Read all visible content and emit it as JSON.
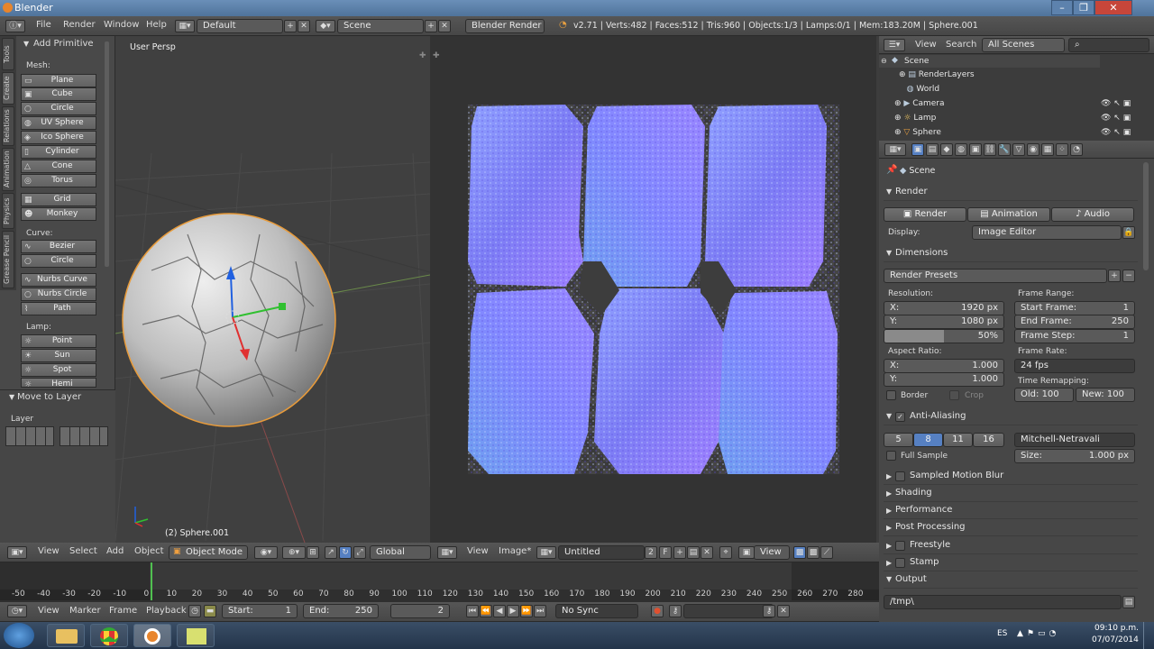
{
  "window": {
    "title": "Blender",
    "controls": [
      "–",
      "❐",
      "✕"
    ]
  },
  "info_header": {
    "menus": [
      "File",
      "Render",
      "Window",
      "Help"
    ],
    "screen_layout": "Default",
    "scene": "Scene",
    "engine": "Blender Render",
    "stats": "v2.71 | Verts:482 | Faces:512 | Tris:960 | Objects:1/3 | Lamps:0/1 | Mem:183.20M | Sphere.001"
  },
  "tool_shelf": {
    "tabs": [
      "Tools",
      "Create",
      "Relations",
      "Animation",
      "Physics",
      "Grease Pencil"
    ],
    "panel_title": "Add Primitive",
    "mesh_label": "Mesh:",
    "mesh": [
      "Plane",
      "Cube",
      "Circle",
      "UV Sphere",
      "Ico Sphere",
      "Cylinder",
      "Cone",
      "Torus"
    ],
    "mesh2": [
      "Grid",
      "Monkey"
    ],
    "curve_label": "Curve:",
    "curve": [
      "Bezier",
      "Circle"
    ],
    "curve2": [
      "Nurbs Curve",
      "Nurbs Circle",
      "Path"
    ],
    "lamp_label": "Lamp:",
    "lamp": [
      "Point",
      "Sun",
      "Spot",
      "Hemi"
    ],
    "move_to_layer": "Move to Layer",
    "layer_label": "Layer"
  },
  "viewport": {
    "view_name": "User Persp",
    "object_info": "(2) Sphere.001"
  },
  "viewport_header": {
    "menus": [
      "View",
      "Select",
      "Add",
      "Object"
    ],
    "mode": "Object Mode",
    "orientation": "Global"
  },
  "image_editor_header": {
    "menus": [
      "View",
      "Image*"
    ],
    "image_name": "Untitled",
    "users": "2",
    "fake": "F",
    "view_menu": "View"
  },
  "outliner": {
    "menus": [
      "View",
      "Search"
    ],
    "filter": "All Scenes",
    "items": [
      "Scene",
      "RenderLayers",
      "World",
      "Camera",
      "Lamp",
      "Sphere"
    ]
  },
  "properties": {
    "context": "Scene",
    "render": {
      "title": "Render",
      "buttons": [
        "Render",
        "Animation",
        "Audio"
      ],
      "display_label": "Display:",
      "display": "Image Editor"
    },
    "dimensions": {
      "title": "Dimensions",
      "presets": "Render Presets",
      "resolution_label": "Resolution:",
      "res_x": "X:",
      "res_x_val": "1920 px",
      "res_y": "Y:",
      "res_y_val": "1080 px",
      "percent": "50%",
      "aspect_label": "Aspect Ratio:",
      "asp_x": "X:",
      "asp_x_val": "1.000",
      "asp_y": "Y:",
      "asp_y_val": "1.000",
      "border": "Border",
      "crop": "Crop",
      "frame_range_label": "Frame Range:",
      "start_frame": "Start Frame:",
      "start_frame_val": "1",
      "end_frame": "End Frame:",
      "end_frame_val": "250",
      "frame_step": "Frame Step:",
      "frame_step_val": "1",
      "frame_rate_label": "Frame Rate:",
      "fps": "24 fps",
      "time_remap_label": "Time Remapping:",
      "old": "Old:",
      "old_val": "100",
      "new": "New:",
      "new_val": "100"
    },
    "aa": {
      "title": "Anti-Aliasing",
      "samples": [
        "5",
        "8",
        "11",
        "16"
      ],
      "filter": "Mitchell-Netravali",
      "full_sample": "Full Sample",
      "size": "Size:",
      "size_val": "1.000 px"
    },
    "collapsed": [
      "Sampled Motion Blur",
      "Shading",
      "Performance",
      "Post Processing",
      "Freestyle",
      "Stamp"
    ],
    "output_title": "Output",
    "output_path": "/tmp\\"
  },
  "timeline": {
    "ticks": [
      "-50",
      "-40",
      "-30",
      "-20",
      "-10",
      "0",
      "10",
      "20",
      "30",
      "40",
      "50",
      "60",
      "70",
      "80",
      "90",
      "100",
      "110",
      "120",
      "130",
      "140",
      "150",
      "160",
      "170",
      "180",
      "190",
      "200",
      "210",
      "220",
      "230",
      "240",
      "250",
      "260",
      "270",
      "280"
    ],
    "menus": [
      "View",
      "Marker",
      "Frame",
      "Playback"
    ],
    "start": "Start:",
    "start_val": "1",
    "end": "End:",
    "end_val": "250",
    "current": "2",
    "sync": "No Sync"
  },
  "taskbar": {
    "lang": "ES",
    "time": "09:10 p.m.",
    "date": "07/07/2014"
  }
}
